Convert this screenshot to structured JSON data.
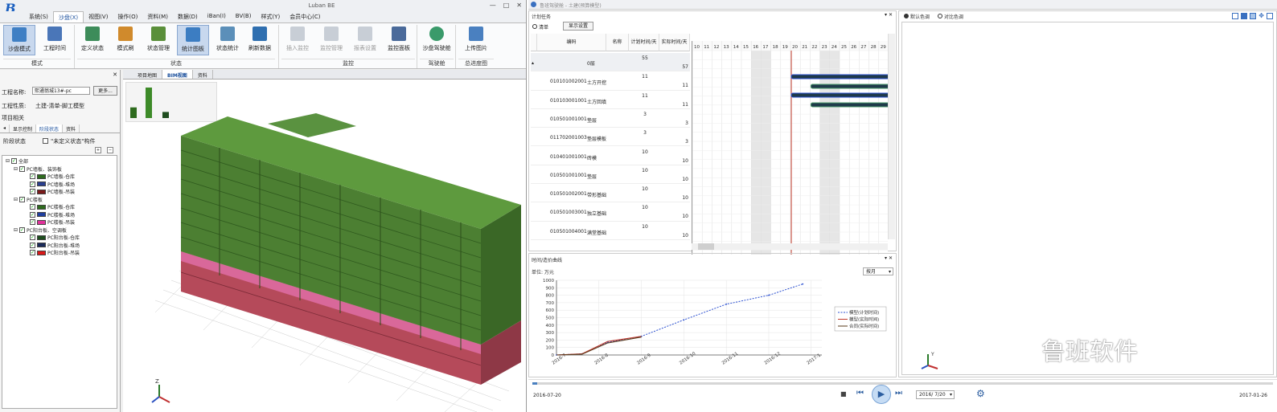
{
  "left_app": {
    "title": "Luban BE",
    "menu": [
      "系统(S)",
      "沙盘(X)",
      "视图(V)",
      "操作(O)",
      "资料(M)",
      "数据(D)",
      "iBan(I)",
      "BV(B)",
      "样式(Y)",
      "会员中心(C)"
    ],
    "ribbon": {
      "buttons": [
        {
          "label": "沙盘模式",
          "color": "#3f7fc4"
        },
        {
          "label": "工程时间",
          "color": "#4a76b8"
        },
        {
          "label": "定义状态",
          "color": "#3d8c5a"
        },
        {
          "label": "模式刷",
          "color": "#d08a2c"
        },
        {
          "label": "状态管理",
          "color": "#5a8f3a"
        },
        {
          "label": "统计图板",
          "color": "#3c7dc2"
        },
        {
          "label": "状态统计",
          "color": "#5b8fb9"
        },
        {
          "label": "刷新数据",
          "color": "#2f6fb0"
        },
        {
          "label": "插入监控",
          "color": "#b0b8c4"
        },
        {
          "label": "监控管理",
          "color": "#b0b8c4"
        },
        {
          "label": "报表设置",
          "color": "#b0b8c4"
        },
        {
          "label": "监控面板",
          "color": "#4a6a9a"
        },
        {
          "label": "沙盘驾驶舱",
          "color": "#3a9a6a"
        },
        {
          "label": "上传图片",
          "color": "#4a80c0"
        }
      ],
      "groups": [
        "模式",
        "状态",
        "监控",
        "驾驶舱",
        "总进度图"
      ]
    },
    "left_panel": {
      "project_label": "工程名称:",
      "project_value": "熙通翁城13#-pc",
      "more": "更多...",
      "nature_label": "工程性质:",
      "nature_value": "土建-清单-脚工模型",
      "related": "项目相关",
      "tabs": [
        "显示控制",
        "阶段状态",
        "资料"
      ],
      "stage_label": "阶段状态",
      "undefined_label": "\"未定义状态\"构件",
      "tree": {
        "root": "全部",
        "groups": [
          {
            "name": "PC墙板、装饰板",
            "items": [
              {
                "label": "PC墙板-仓库",
                "color": "#2e6b1e"
              },
              {
                "label": "PC墙板-堆场",
                "color": "#2a3f8f"
              },
              {
                "label": "PC墙板-吊装",
                "color": "#7a1a1a"
              }
            ]
          },
          {
            "name": "PC楼板",
            "items": [
              {
                "label": "PC楼板-仓库",
                "color": "#2e6b1e"
              },
              {
                "label": "PC楼板-堆场",
                "color": "#1f3f9f"
              },
              {
                "label": "PC楼板-吊装",
                "color": "#e0329a"
              }
            ]
          },
          {
            "name": "PC阳台板、空调板",
            "items": [
              {
                "label": "PC阳台板-仓库",
                "color": "#1e4d1e"
              },
              {
                "label": "PC阳台板-堆场",
                "color": "#1a2a5a"
              },
              {
                "label": "PC阳台板-吊装",
                "color": "#d81818"
              }
            ]
          }
        ]
      }
    },
    "viewport": {
      "tabs": [
        "项目地图",
        "BIM视图",
        "资料"
      ],
      "mini_chart_values": [
        35,
        100,
        20
      ]
    }
  },
  "right_app": {
    "title": "鲁班驾驶舱 - 土建(预算模型)",
    "plan": {
      "title": "计划任务",
      "list_label": "清单",
      "display_settings": "显示设置",
      "headers": [
        "编码",
        "名称",
        "计划时间/天",
        "实际时间/天"
      ],
      "days": [
        "10",
        "11",
        "12",
        "13",
        "14",
        "15",
        "16",
        "17",
        "18",
        "19",
        "20",
        "21",
        "22",
        "23",
        "24",
        "25",
        "26",
        "27",
        "28",
        "29"
      ],
      "rows": [
        {
          "code": "0层",
          "name": "",
          "plan": "55",
          "actual": "57"
        },
        {
          "code": "010101002001",
          "name": "土方开挖",
          "plan": "11",
          "actual": "11"
        },
        {
          "code": "010103001001",
          "name": "土方回填",
          "plan": "11",
          "actual": "11"
        },
        {
          "code": "010501001001",
          "name": "垫层",
          "plan": "3",
          "actual": "3"
        },
        {
          "code": "011702001003",
          "name": "垫层模板",
          "plan": "3",
          "actual": "3"
        },
        {
          "code": "010401001001",
          "name": "砖模",
          "plan": "10",
          "actual": "10"
        },
        {
          "code": "010501001001",
          "name": "垫层",
          "plan": "10",
          "actual": "10"
        },
        {
          "code": "010501002001",
          "name": "带形基础",
          "plan": "10",
          "actual": "10"
        },
        {
          "code": "010501003001",
          "name": "独立基础",
          "plan": "10",
          "actual": "10"
        },
        {
          "code": "010501004001",
          "name": "满堂基础",
          "plan": "10",
          "actual": "10"
        }
      ]
    },
    "curve": {
      "title": "时间/造价曲线",
      "unit": "单位: 万元",
      "period": "按月"
    },
    "chart_data": {
      "type": "line",
      "x": [
        "2016-7",
        "2016-8",
        "2016-9",
        "2016-10",
        "2016-11",
        "2016-12",
        "2017-1"
      ],
      "ylim": [
        0,
        1000
      ],
      "yticks": [
        "0",
        "100",
        "200",
        "300",
        "400",
        "500",
        "600",
        "700",
        "800",
        "900",
        "1000"
      ],
      "series": [
        {
          "name": "模型(计划时间)",
          "color": "#2a4fd0",
          "values": [
            0,
            15,
            170,
            250,
            470,
            680,
            800,
            950
          ]
        },
        {
          "name": "模型(实际时间)",
          "color": "#c0392b",
          "values": [
            0,
            15,
            180,
            250
          ]
        },
        {
          "name": "合同(实际时间)",
          "color": "#5a3a1a",
          "values": [
            0,
            10,
            160,
            240
          ]
        }
      ]
    },
    "model_view": {
      "opt1": "默认色调",
      "opt2": "对比色调"
    },
    "player": {
      "start": "2016-07-20",
      "current": "2016/ 7/20",
      "end": "2017-01-26"
    }
  },
  "watermark": "鲁班软件"
}
